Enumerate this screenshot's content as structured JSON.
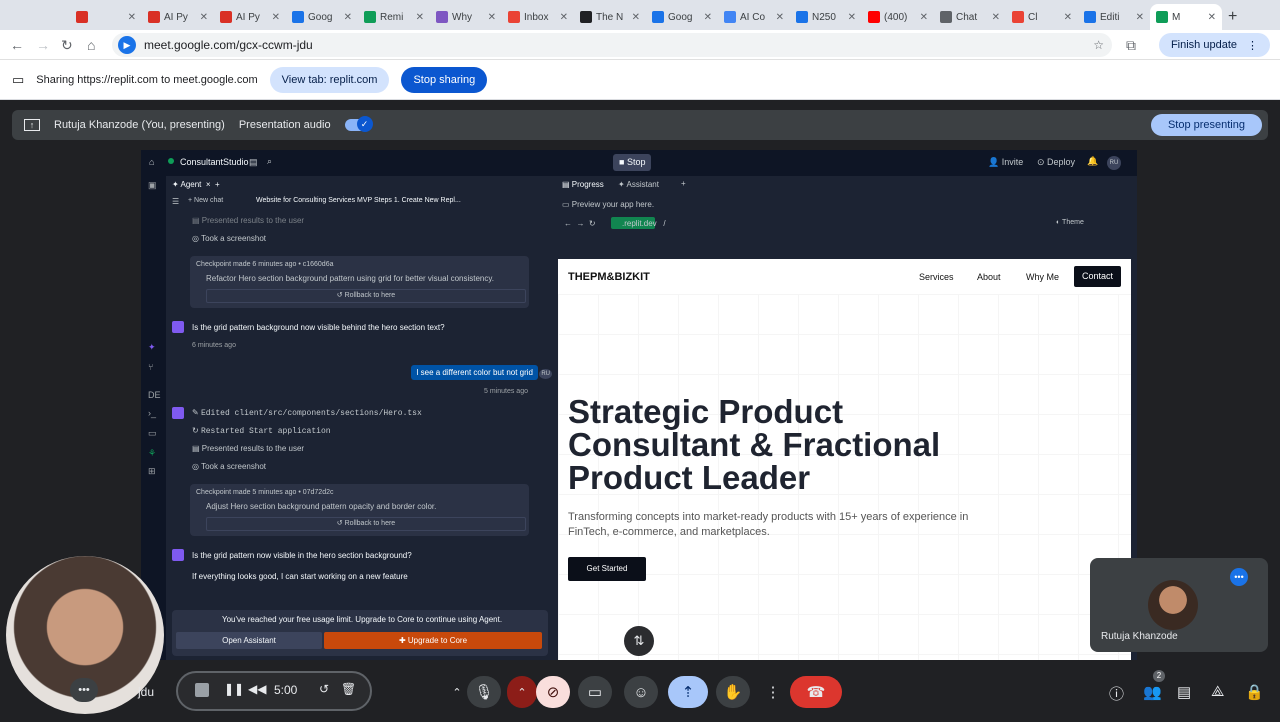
{
  "browser": {
    "tabs": [
      {
        "label": "",
        "color": "#d93025"
      },
      {
        "label": "AI Py",
        "color": "#d93025"
      },
      {
        "label": "AI Py",
        "color": "#d93025"
      },
      {
        "label": "Goog",
        "color": "#1a73e8"
      },
      {
        "label": "Remi",
        "color": "#0f9d58"
      },
      {
        "label": "Why",
        "color": "#7e57c2"
      },
      {
        "label": "Inbox",
        "color": "#ea4335"
      },
      {
        "label": "The N",
        "color": "#202124"
      },
      {
        "label": "Goog",
        "color": "#1a73e8"
      },
      {
        "label": "AI Co",
        "color": "#4285f4"
      },
      {
        "label": "N250",
        "color": "#1a73e8"
      },
      {
        "label": "(400)",
        "color": "#ff0000"
      },
      {
        "label": "Chat",
        "color": "#5f6368"
      },
      {
        "label": "Cl",
        "color": "#ea4335"
      },
      {
        "label": "Editi",
        "color": "#1a73e8"
      },
      {
        "label": "M",
        "color": "#0f9d58"
      }
    ],
    "url": "meet.google.com/gcx-ccwm-jdu",
    "finish_update": "Finish update"
  },
  "sharing": {
    "text": "Sharing https://replit.com to meet.google.com",
    "view_tab": "View tab: replit.com",
    "stop_sharing": "Stop sharing"
  },
  "presenting": {
    "name": "Rutuja Khanzode (You, presenting)",
    "audio": "Presentation audio",
    "stop": "Stop presenting"
  },
  "replit": {
    "app_name": "ConsultantStudio",
    "stop": "Stop",
    "invite": "Invite",
    "deploy": "Deploy",
    "avatar": "RU",
    "agent_tab": "Agent",
    "new_chat": "New chat",
    "chat_title": "Website for Consulting Services MVP Steps 1. Create New Repl...",
    "progress_tab": "Progress",
    "assistant_tab": "Assistant",
    "preview_hint": "Preview your app here.",
    "url_domain": ".replit.dev",
    "url_path": "/",
    "theme": "Theme",
    "messages": {
      "presented1": "Presented results to the user",
      "screenshot1": "Took a screenshot",
      "chk1_meta": "Checkpoint made 6 minutes ago • c1660d6a",
      "chk1_text": "Refactor Hero section background pattern using grid for better visual consistency.",
      "rollback": "Rollback to here",
      "q1": "Is the grid pattern background now visible behind the hero section text?",
      "q1_time": "6 minutes ago",
      "user_msg": "I see a different color but not grid",
      "user_avatar": "RU",
      "user_time": "5 minutes ago",
      "edited": "Edited client/src/components/sections/Hero.tsx",
      "restarted": "Restarted Start application",
      "presented2": "Presented results to the user",
      "screenshot2": "Took a screenshot",
      "chk2_meta": "Checkpoint made 5 minutes ago • 07d72d2c",
      "chk2_text": "Adjust Hero section background pattern opacity and border color.",
      "q2": "Is the grid pattern now visible in the hero section background?",
      "q2_b": "If everything looks good, I can start working on a new feature"
    },
    "limit_text": "You've reached your free usage limit. Upgrade to Core to continue using Agent.",
    "open_assistant": "Open Assistant",
    "upgrade": "Upgrade to Core"
  },
  "website": {
    "logo": "THEPM&BIZKIT",
    "nav": [
      "Services",
      "About",
      "Why Me"
    ],
    "contact": "Contact",
    "hero_line1": "Strategic Product",
    "hero_line2": "Consultant & Fractional",
    "hero_line3": "Product Leader",
    "sub_line1": "Transforming concepts into market-ready products with 15+ years of experience in",
    "sub_line2": "FinTech, e-commerce, and marketplaces.",
    "cta": "Get Started"
  },
  "meet": {
    "participant": "Rutuja Khanzode",
    "self_suffix": "jdu",
    "timer": "5:00",
    "people_count": "2"
  }
}
